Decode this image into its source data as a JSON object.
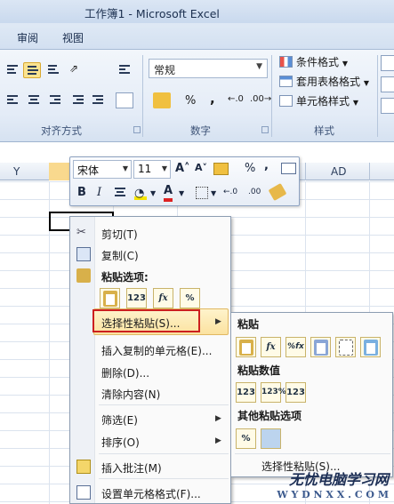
{
  "window": {
    "title": "工作簿1  -  Microsoft Excel"
  },
  "ribbon": {
    "tabs": [
      "审阅",
      "视图"
    ],
    "groups": {
      "alignment": "对齐方式",
      "number": "数字",
      "styles": "样式"
    },
    "number_format": "常规",
    "number_symbols": {
      "percent": "%",
      "comma": ","
    },
    "styles": {
      "conditional": "条件格式",
      "table": "套用表格格式",
      "cell": "单元格样式"
    }
  },
  "sheet": {
    "columns": [
      "Y",
      "AD"
    ],
    "selected_color": "#f9d98e"
  },
  "mini_toolbar": {
    "font": "宋体",
    "size": "11",
    "grow": "A˄",
    "shrink": "A˅",
    "percent": "%",
    "comma": ",",
    "bold": "B",
    "italic": "I",
    "font_color_letter": "A"
  },
  "context_menu": {
    "cut": "剪切(T)",
    "copy": "复制(C)",
    "paste_options": "粘贴选项:",
    "paste_icons": [
      "123",
      "fx",
      "%"
    ],
    "paste_special": "选择性粘贴(S)...",
    "insert_copied": "插入复制的单元格(E)...",
    "delete": "删除(D)...",
    "clear": "清除内容(N)",
    "filter": "筛选(E)",
    "sort": "排序(O)",
    "insert_comment": "插入批注(M)",
    "format_cells": "设置单元格格式(F)..."
  },
  "submenu": {
    "paste_heading": "粘贴",
    "paste_icons": [
      "fx",
      "%fx"
    ],
    "values_heading": "粘贴数值",
    "values_icons": [
      "123",
      "123%",
      "123"
    ],
    "other_heading": "其他粘贴选项",
    "other_icons": [
      "%"
    ],
    "paste_special": "选择性粘贴(S)..."
  },
  "watermark": {
    "line1": "无忧电脑学习网",
    "line2": "W Y D N X X . C O M"
  },
  "colors": {
    "highlight": "#fbe2a0",
    "redbox": "#cc1f1f",
    "accent": "#1b2f4f"
  }
}
